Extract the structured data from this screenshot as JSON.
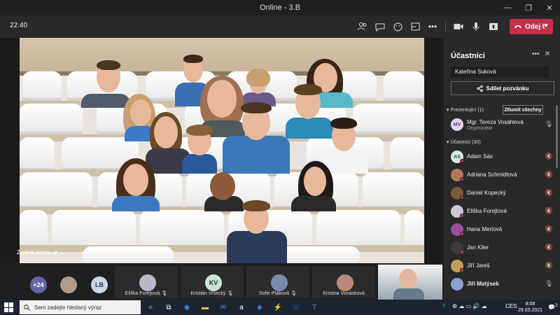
{
  "window": {
    "title": "Online - 3.B"
  },
  "toolbar": {
    "timer": "22:40",
    "leave_label": "Odejít"
  },
  "stage": {
    "change_scene_label": "Změnit scénu"
  },
  "gallery": {
    "overflow_count": "+24",
    "lb_initials": "LB",
    "tiles": [
      {
        "name": "Eliška Forejtová"
      },
      {
        "name": "Kristián Vršecký",
        "initials": "KV"
      },
      {
        "name": "Sofie Ptáková"
      },
      {
        "name": "Kristina Vonásková"
      }
    ]
  },
  "panel": {
    "title": "Účastníci",
    "invite_value": "Kateřina Suková",
    "share_label": "Sdílet pozvánku",
    "presenters_header": "Prezentující (1)",
    "mute_all_label": "Ztlumit všechny",
    "participants_header": "Účastníci (30)",
    "presenter": {
      "initials": "MV",
      "name": "Mgr. Tereza Vosáhlová",
      "role": "Organizátor"
    },
    "participants": [
      {
        "initials": "AS",
        "name": "Adam Sás",
        "color": "#d4e7e1"
      },
      {
        "name": "Adriana Schmidtová",
        "color": "#b07a5a"
      },
      {
        "name": "Daniel Kopecký",
        "color": "#7a5a3a"
      },
      {
        "name": "Eliška Forejtová",
        "color": "#c8c8d8"
      },
      {
        "name": "Hana Mertová",
        "color": "#9a4fa0"
      },
      {
        "name": "Jan Klier",
        "color": "#3a3a3a"
      },
      {
        "name": "Jiří Jareš",
        "color": "#c89a5a"
      },
      {
        "name": "Jiří Matýsek",
        "color": "#8fa0d0"
      }
    ]
  },
  "taskbar": {
    "search_placeholder": "Sem zadejte hledaný výraz",
    "language": "CES",
    "time": "8:08",
    "date": "29.03.2021",
    "notifications": "2"
  },
  "colors": {
    "leave": "#c4314b",
    "panel": "#292929",
    "toolbar": "#292929"
  }
}
